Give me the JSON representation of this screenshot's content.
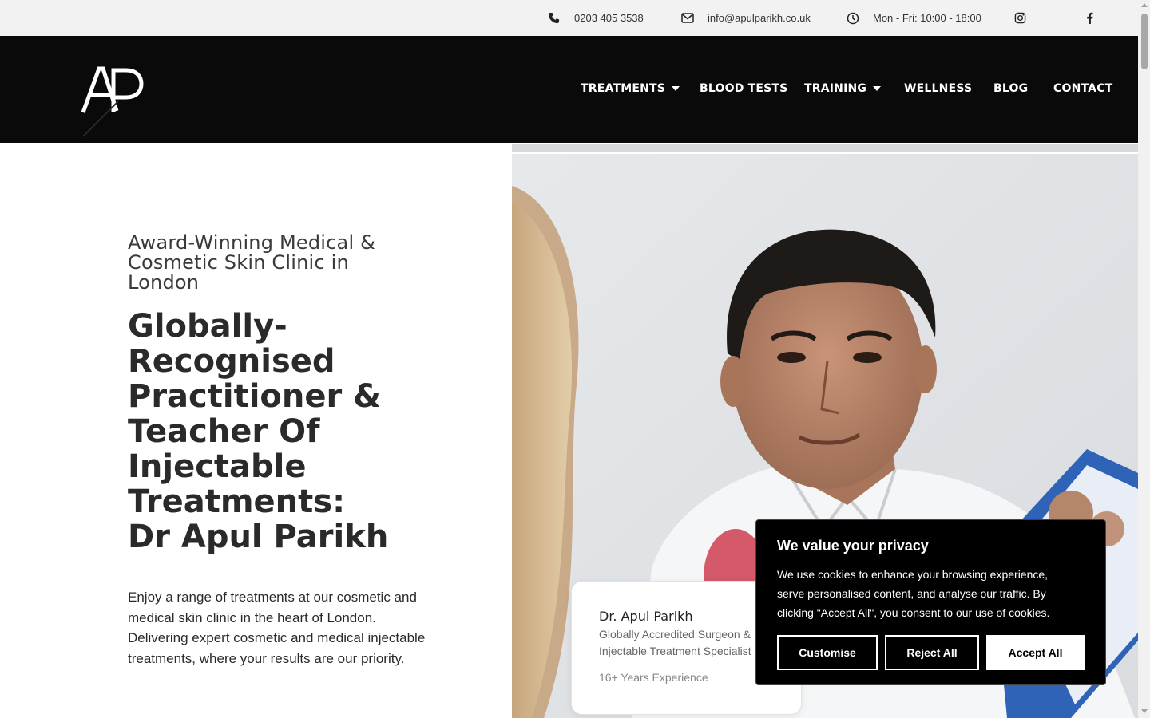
{
  "topbar": {
    "phone": "0203 405 3538",
    "email": "info@apulparikh.co.uk",
    "hours": "Mon - Fri: 10:00 - 18:00",
    "icons": [
      "phone-icon",
      "envelope-icon",
      "clock-icon",
      "instagram-icon",
      "facebook-icon"
    ]
  },
  "header": {
    "logo_text": "AP",
    "nav": [
      {
        "label": "TREATMENTS",
        "has_dropdown": true
      },
      {
        "label": "BLOOD TESTS",
        "has_dropdown": false
      },
      {
        "label": "TRAINING",
        "has_dropdown": true
      },
      {
        "label": "WELLNESS",
        "has_dropdown": false
      },
      {
        "label": "BLOG",
        "has_dropdown": false
      },
      {
        "label": "CONTACT",
        "has_dropdown": false
      }
    ]
  },
  "hero": {
    "tagline": "Award-Winning Medical & Cosmetic Skin Clinic in London",
    "headline": "Globally-Recognised Practitioner & Teacher Of Injectable Treatments:",
    "name": "Dr Apul Parikh",
    "intro": "Enjoy a range of treatments at our cosmetic and medical skin clinic in the heart of London. Delivering expert cosmetic and medical injectable treatments, where your results are our priority."
  },
  "doctor_card": {
    "name": "Dr. Apul Parikh",
    "role": "Globally Accredited Surgeon & Injectable Treatment Specialist",
    "experience": "16+ Years Experience"
  },
  "cookie_banner": {
    "title": "We value your privacy",
    "text": "We use cookies to enhance your browsing experience, serve personalised content, and analyse our traffic. By clicking \"Accept All\", you consent to our use of cookies.",
    "customise_label": "Customise",
    "reject_label": "Reject All",
    "accept_label": "Accept All"
  },
  "colors": {
    "header_bg": "#0a0a0a",
    "topbar_bg": "#f2f2f2",
    "name_highlight": "#dfe9f7"
  }
}
